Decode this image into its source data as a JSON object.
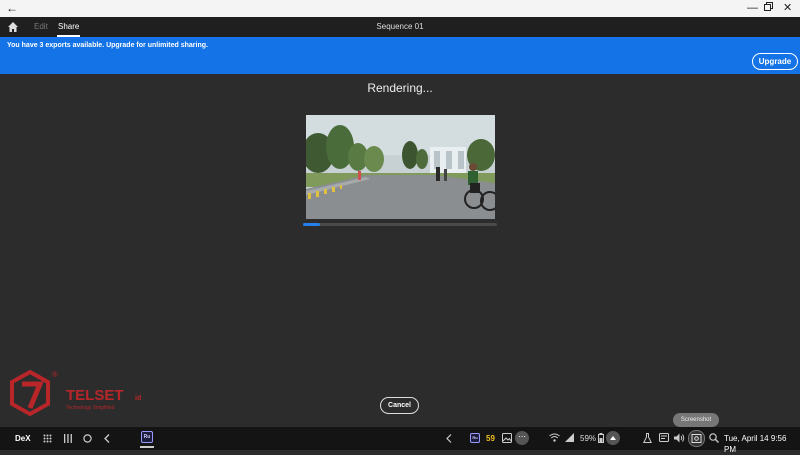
{
  "window": {
    "back_icon": "arrow-left-icon",
    "controls": [
      "minimize-icon",
      "restore-icon",
      "close-icon"
    ]
  },
  "header": {
    "tabs": [
      {
        "label": "Edit"
      },
      {
        "label": "Share"
      }
    ],
    "active_tab": "Share",
    "title": "Sequence 01"
  },
  "banner": {
    "message": "You have 3 exports available. Upgrade for unlimited sharing.",
    "upgrade_label": "Upgrade",
    "color": "#1473e6"
  },
  "render": {
    "status": "Rendering...",
    "progress": 0.09,
    "cancel_label": "Cancel",
    "progress_color": "#2680eb"
  },
  "watermark": {
    "brand": "TELSET",
    "suffix": "id",
    "tagline": "Technology Simplified"
  },
  "tooltip": {
    "label": "Screenshot"
  },
  "taskbar": {
    "dex_label": "DeX",
    "app_badge": "Ru",
    "tray_badge_value": "59",
    "battery": "59%",
    "datetime": "Tue, April 14 9:56 PM"
  }
}
